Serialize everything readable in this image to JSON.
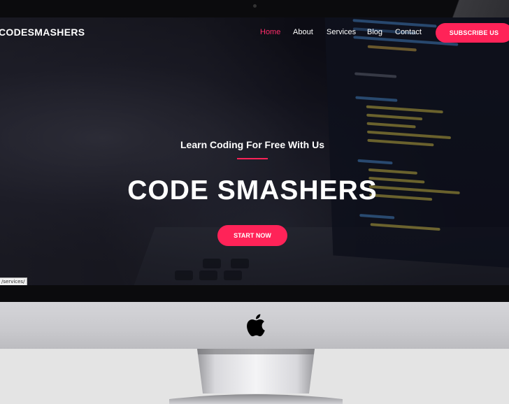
{
  "site": {
    "logo": "CODESMASHERS",
    "nav": [
      {
        "label": "Home",
        "active": true
      },
      {
        "label": "About",
        "active": false
      },
      {
        "label": "Services",
        "active": false
      },
      {
        "label": "Blog",
        "active": false
      },
      {
        "label": "Contact",
        "active": false
      }
    ],
    "subscribe_label": "SUBSCRIBE US"
  },
  "hero": {
    "tagline": "Learn Coding For Free With Us",
    "title": "CODE SMASHERS",
    "cta_label": "START NOW"
  },
  "status_bar": {
    "url": "/services/"
  },
  "icons": {
    "brand_logo": "apple-logo-icon"
  },
  "colors": {
    "accent": "#ff2358",
    "active_nav": "#ff2d6a",
    "bezel": "#0b0b0d",
    "chin": "#d5d5d9",
    "page_bg": "#e4e4e4"
  }
}
